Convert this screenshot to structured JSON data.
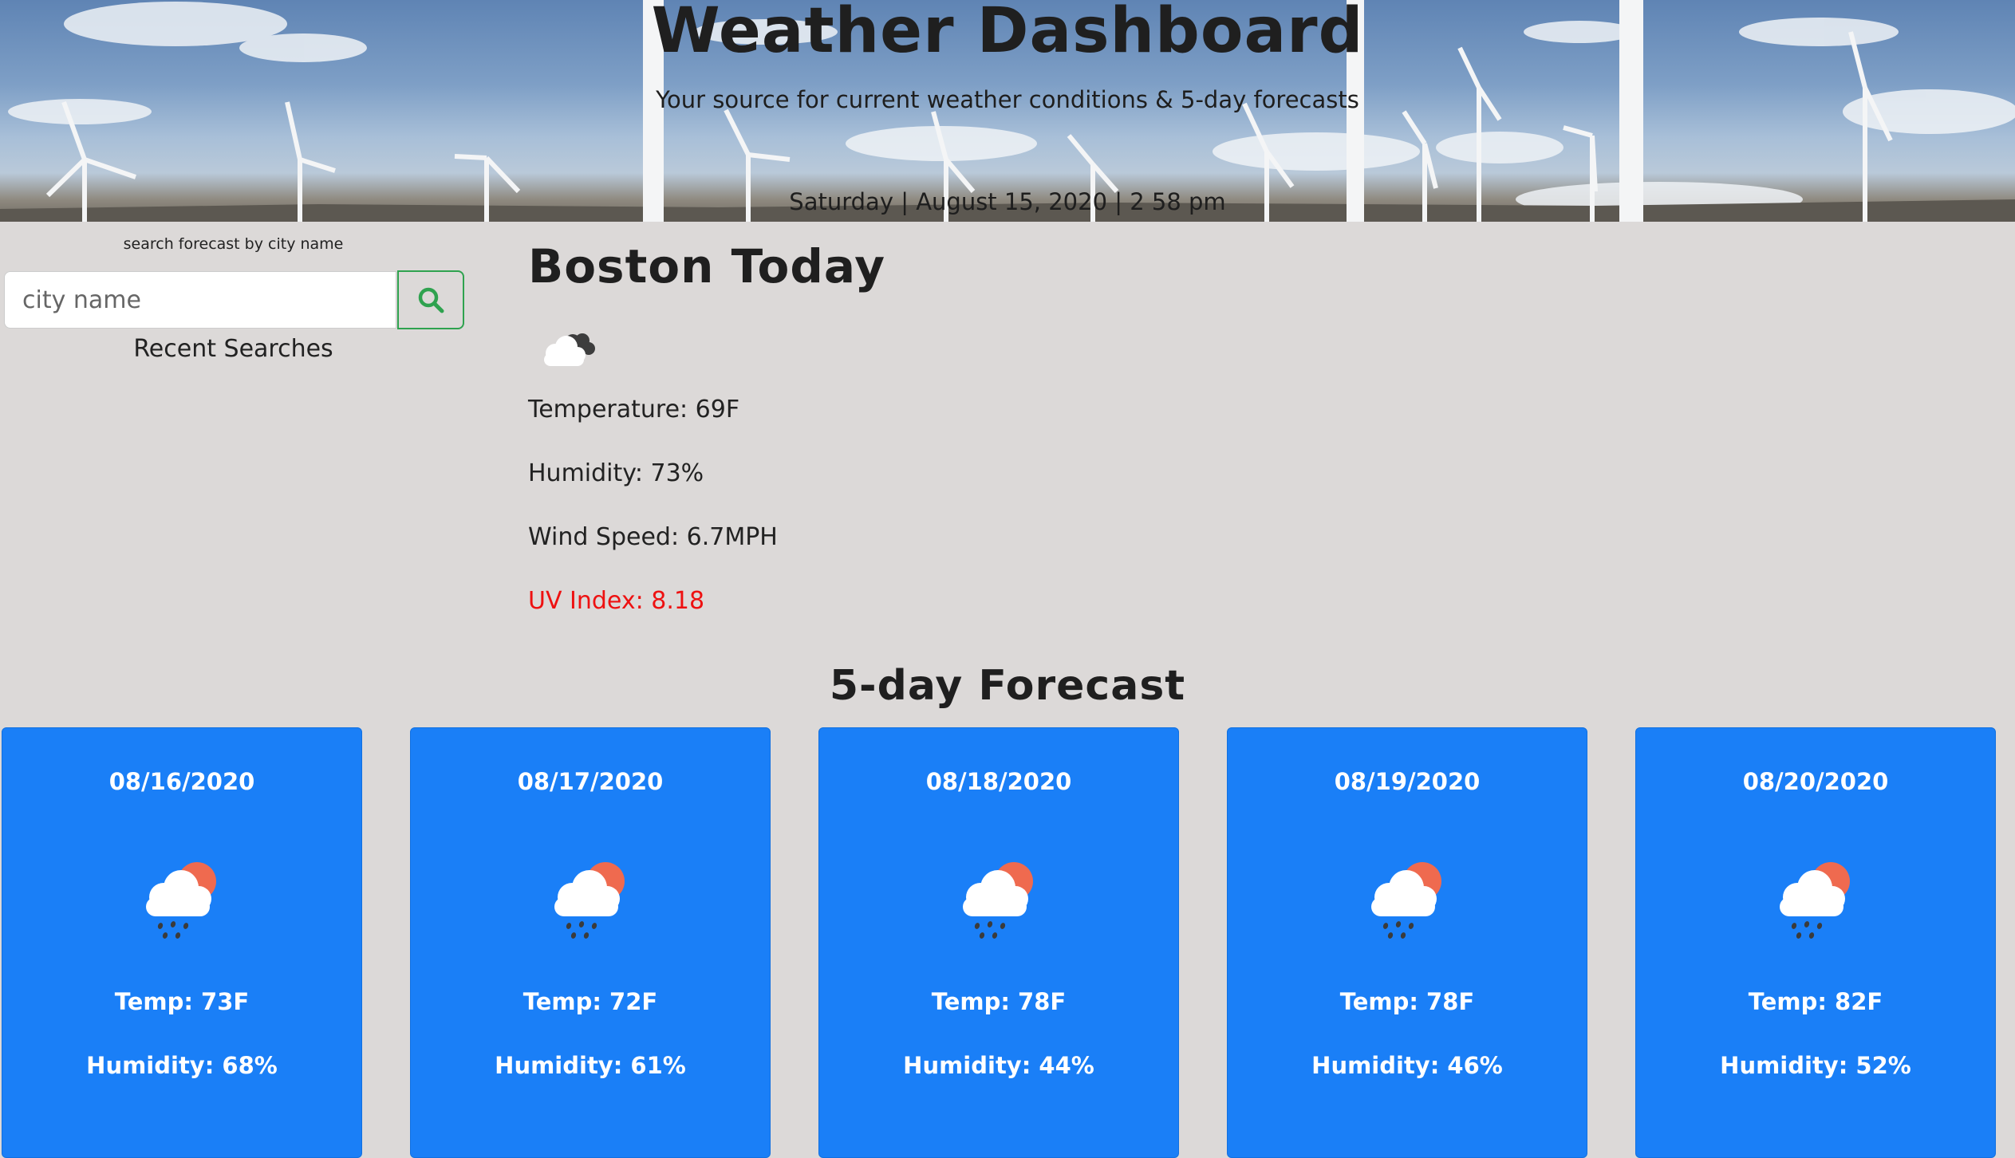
{
  "header": {
    "title": "Weather Dashboard",
    "subtitle": "Your source for current weather conditions & 5-day forecasts",
    "datetime": "Saturday | August 15, 2020 | 2 58 pm"
  },
  "sidebar": {
    "search_label": "search forecast by city name",
    "search_placeholder": "city name",
    "search_icon": "search-icon",
    "recent_title": "Recent Searches"
  },
  "today": {
    "title": "Boston Today",
    "icon": "cloudy-icon",
    "temperature": "Temperature: 69F",
    "humidity": "Humidity: 73%",
    "wind": "Wind Speed: 6.7MPH",
    "uv": "UV Index: 8.18",
    "uv_color": "#ee1111"
  },
  "forecast": {
    "title": "5-day Forecast",
    "card_color": "#1a7ff7",
    "days": [
      {
        "date": "08/16/2020",
        "icon": "rain-sun-icon",
        "temp": "Temp: 73F",
        "humidity": "Humidity: 68%"
      },
      {
        "date": "08/17/2020",
        "icon": "rain-sun-icon",
        "temp": "Temp: 72F",
        "humidity": "Humidity: 61%"
      },
      {
        "date": "08/18/2020",
        "icon": "rain-sun-icon",
        "temp": "Temp: 78F",
        "humidity": "Humidity: 44%"
      },
      {
        "date": "08/19/2020",
        "icon": "rain-sun-icon",
        "temp": "Temp: 78F",
        "humidity": "Humidity: 46%"
      },
      {
        "date": "08/20/2020",
        "icon": "rain-sun-icon",
        "temp": "Temp: 82F",
        "humidity": "Humidity: 52%"
      }
    ]
  }
}
